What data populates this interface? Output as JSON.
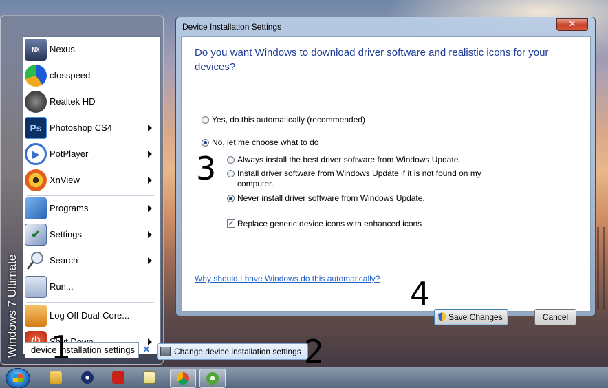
{
  "start_menu": {
    "os_label": "Windows 7 Ultimate",
    "pinned": [
      {
        "label": "Nexus",
        "icon": "nexus-icon"
      },
      {
        "label": "cfosspeed",
        "icon": "cfosspeed-icon"
      },
      {
        "label": "Realtek HD",
        "icon": "speaker-icon"
      },
      {
        "label": "Photoshop CS4",
        "icon": "photoshop-icon"
      },
      {
        "label": "PotPlayer",
        "icon": "potplayer-icon"
      },
      {
        "label": "XnView",
        "icon": "xnview-icon"
      }
    ],
    "system": [
      {
        "label": "Programs",
        "icon": "programs-icon"
      },
      {
        "label": "Settings",
        "icon": "settings-icon"
      },
      {
        "label": "Search",
        "icon": "search-icon"
      },
      {
        "label": "Run...",
        "icon": "run-icon"
      }
    ],
    "logoff_label": "Log Off Dual-Core...",
    "shutdown_label": "Shut Down...",
    "search_value": "device installation settings",
    "clear_glyph": "×"
  },
  "search_result": {
    "label": "Change device installation settings",
    "icon": "device-settings-icon"
  },
  "dialog": {
    "title": "Device Installation Settings",
    "close_glyph": "✕",
    "question": "Do you want Windows to download driver software and realistic icons for your devices?",
    "option_yes": "Yes, do this automatically (recommended)",
    "option_no": "No, let me choose what to do",
    "sub_always": "Always install the best driver software from Windows Update.",
    "sub_if_not_found": "Install driver software from Windows Update if it is not found on my computer.",
    "sub_never": "Never install driver software from Windows Update.",
    "replace_icons": "Replace generic device icons with enhanced icons",
    "replace_icons_checked": true,
    "help_link": "Why should I have Windows do this automatically?",
    "save_label": "Save Changes",
    "cancel_label": "Cancel",
    "selected_main": "no",
    "selected_sub": "never"
  },
  "steps": [
    "1",
    "2",
    "3",
    "4"
  ],
  "taskbar": {
    "apps": [
      "explorer-icon",
      "media-player-icon",
      "pdf-icon",
      "notepad-icon",
      "chrome-icon",
      "utorrent-icon"
    ]
  }
}
